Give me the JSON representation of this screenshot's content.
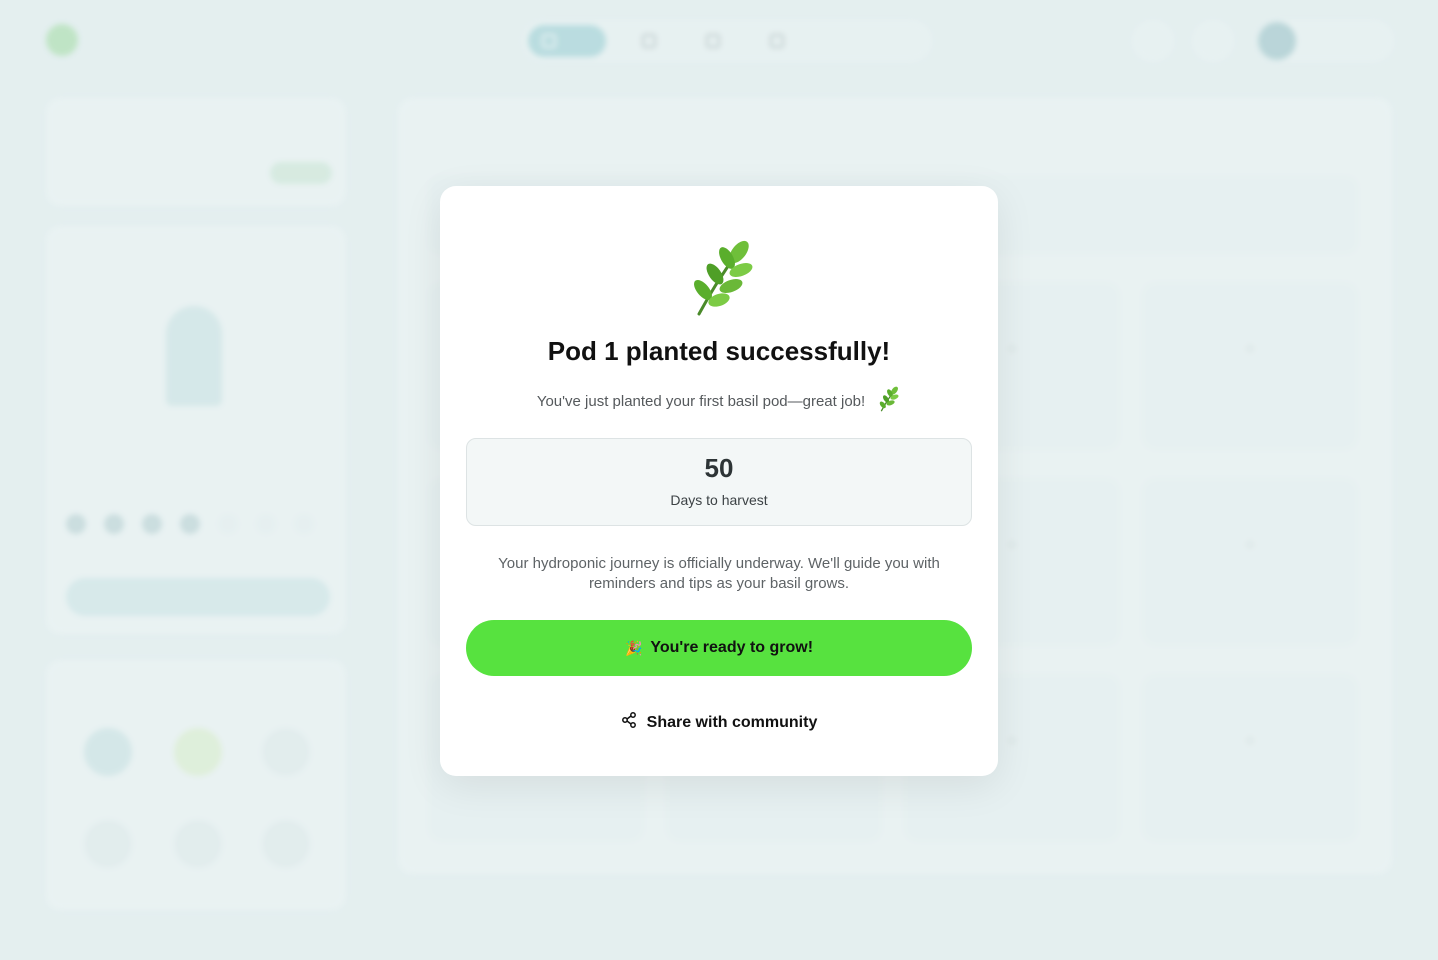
{
  "modal": {
    "emoji_icon": "herb-icon",
    "title": "Pod 1 planted successfully!",
    "subtitle": "You've just planted your first basil pod—great job!",
    "subtitle_emoji": "herb-icon",
    "stat": {
      "value": "50",
      "label": "Days to harvest"
    },
    "description": "Your hydroponic journey is officially underway. We'll guide you with reminders and tips as your basil grows.",
    "primary_button": {
      "emoji": "🎉",
      "label": "You're ready to grow!"
    },
    "share_button": {
      "icon": "share-icon",
      "label": "Share with community"
    }
  },
  "colors": {
    "accent_green": "#57e23f",
    "background": "#e3eeef",
    "modal": "#ffffff"
  }
}
